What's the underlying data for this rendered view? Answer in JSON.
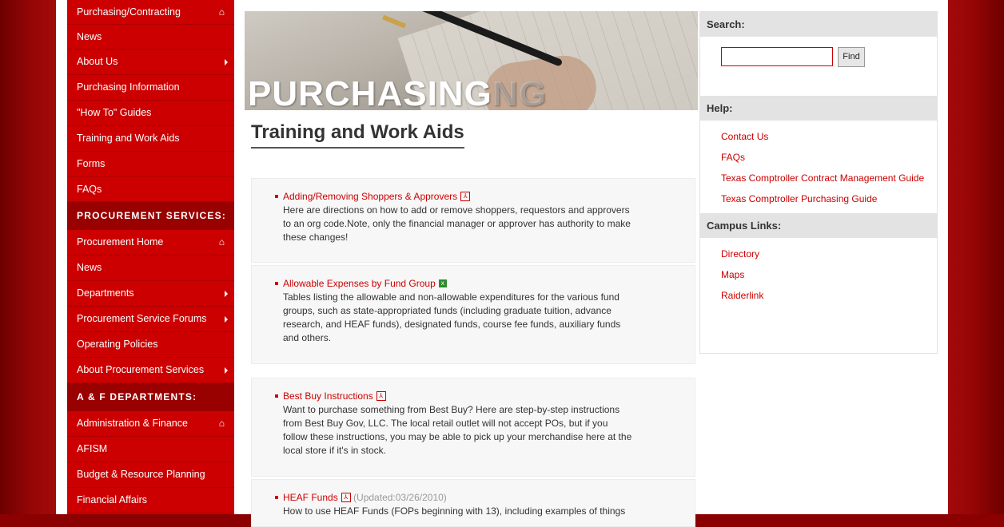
{
  "sidebar": {
    "items_top": [
      {
        "label": "Purchasing/Contracting",
        "icon": "home-icon"
      },
      {
        "label": "News"
      },
      {
        "label": "About Us",
        "icon": "arrow-right-icon"
      },
      {
        "label": "Purchasing Information"
      },
      {
        "label": "\"How To\" Guides"
      },
      {
        "label": "Training and Work Aids"
      },
      {
        "label": "Forms"
      },
      {
        "label": "FAQs"
      }
    ],
    "header_procurement": "PROCUREMENT SERVICES:",
    "items_procurement": [
      {
        "label": "Procurement Home",
        "icon": "home-icon"
      },
      {
        "label": "News"
      },
      {
        "label": "Departments",
        "icon": "arrow-right-icon"
      },
      {
        "label": "Procurement Service Forums",
        "icon": "arrow-right-icon"
      },
      {
        "label": "Operating Policies"
      },
      {
        "label": "About Procurement Services",
        "icon": "arrow-right-icon"
      }
    ],
    "header_af": "A & F DEPARTMENTS:",
    "items_af": [
      {
        "label": "Administration & Finance",
        "icon": "home-icon"
      },
      {
        "label": "AFISM"
      },
      {
        "label": "Budget & Resource Planning"
      },
      {
        "label": "Financial Affairs"
      }
    ]
  },
  "banner": {
    "word": "PURCHASING",
    "ghost": "NG"
  },
  "main": {
    "title": "Training and Work Aids",
    "items": [
      {
        "title": "Adding/Removing Shoppers & Approvers",
        "file_icon": "pdf-icon",
        "desc_lines": [
          "Here are directions on how to add or remove shoppers, requestors and approvers",
          "to an org code.Note, only the financial manager or approver has authority to make",
          "these changes!"
        ]
      },
      {
        "title": "Allowable Expenses by Fund Group",
        "file_icon": "excel-icon",
        "desc_lines": [
          "Tables listing the allowable and non-allowable expenditures for the various fund",
          "groups, such as state-appropriated funds (including graduate tuition, advance",
          "research, and HEAF funds), designated funds, course fee funds, auxiliary funds",
          "and others."
        ]
      },
      {
        "title": "Best Buy Instructions",
        "file_icon": "pdf-icon",
        "desc_lines": [
          "Want to purchase something from Best Buy?  Here are step-by-step instructions",
          "from Best Buy Gov, LLC.  The local retail outlet will not accept POs, but if you",
          "follow these instructions, you may be able to pick up your merchandise here at the",
          "local store if it's in stock."
        ]
      },
      {
        "title": "HEAF Funds",
        "file_icon": "pdf-icon",
        "updated": "(Updated:03/26/2010)",
        "desc_lines": [
          "How to use HEAF Funds (FOPs beginning with 13), including examples of things"
        ]
      }
    ]
  },
  "right": {
    "search_header": "Search:",
    "search_value": "",
    "search_button": "Find",
    "help_header": "Help:",
    "help_links": [
      "Contact Us",
      "FAQs",
      "Texas Comptroller Contract Management Guide",
      "Texas Comptroller Purchasing Guide"
    ],
    "campus_header": "Campus Links:",
    "campus_links": [
      "Directory",
      "Maps",
      "Raiderlink"
    ]
  },
  "colors": {
    "brand_red": "#cc0000",
    "dark_red": "#8b0000",
    "header_red": "#990000"
  }
}
